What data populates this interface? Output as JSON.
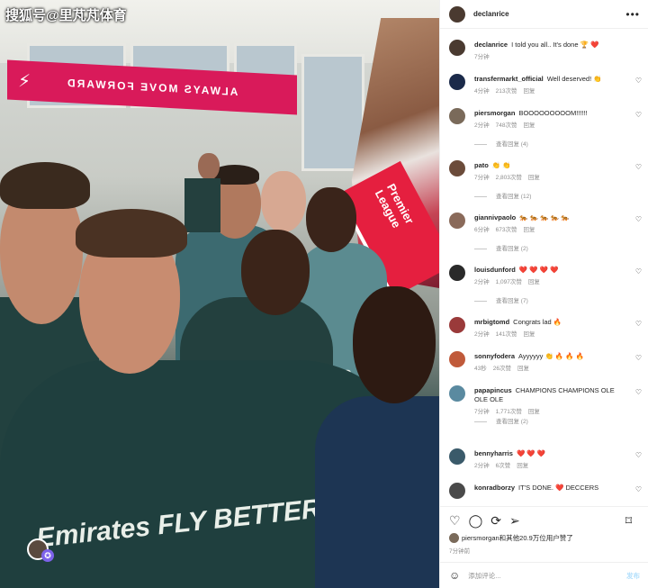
{
  "watermark": "搜狐号@里芃芃体育",
  "photo": {
    "banner_text": "ALWAYS MOVE FORWARD",
    "ribbon_text": "Premier League",
    "shirt_sponsor": "Emirates FLY BETTER"
  },
  "post": {
    "author": "declanrice",
    "more_icon": "more-horizontal-icon"
  },
  "comments": [
    {
      "user": "declanrice",
      "text": "I told you all.. It's done 🏆 ❤️",
      "time": "7分钟",
      "likes": "",
      "reply": "",
      "replies": "",
      "avatar_color": "#4a3a30"
    },
    {
      "user": "transfermarkt_official",
      "text": "Well deserved! 👏",
      "time": "4分钟",
      "likes": "213次赞",
      "reply": "回复",
      "replies": "",
      "avatar_color": "#1b2a4a"
    },
    {
      "user": "piersmorgan",
      "text": "BOOOOOOOOOM!!!!!!",
      "time": "2分钟",
      "likes": "748次赞",
      "reply": "回复",
      "replies": "查看回复 (4)",
      "avatar_color": "#7a6a5a"
    },
    {
      "user": "pato",
      "text": "👏 👏",
      "time": "7分钟",
      "likes": "2,803次赞",
      "reply": "回复",
      "replies": "查看回复 (12)",
      "avatar_color": "#6b4b3a"
    },
    {
      "user": "giannivpaolo",
      "text": "🐅 🐅 🐅 🐅 🐅",
      "time": "6分钟",
      "likes": "673次赞",
      "reply": "回复",
      "replies": "查看回复 (2)",
      "avatar_color": "#8a6a5a"
    },
    {
      "user": "louisdunford",
      "text": "❤️ ❤️ ❤️ ❤️",
      "time": "2分钟",
      "likes": "1,097次赞",
      "reply": "回复",
      "replies": "查看回复 (7)",
      "avatar_color": "#2a2a2a"
    },
    {
      "user": "mrbigtomd",
      "text": "Congrats lad 🔥",
      "time": "2分钟",
      "likes": "141次赞",
      "reply": "回复",
      "replies": "",
      "avatar_color": "#9a3a3a"
    },
    {
      "user": "sonnyfodera",
      "text": "Ayyyyyy 👏 🔥 🔥 🔥",
      "time": "43秒",
      "likes": "26次赞",
      "reply": "回复",
      "replies": "",
      "avatar_color": "#c05a3a"
    },
    {
      "user": "papapincus",
      "text": "CHAMPIONS CHAMPIONS OLE OLE OLE",
      "time": "7分钟",
      "likes": "1,771次赞",
      "reply": "回复",
      "replies": "查看回复 (2)",
      "avatar_color": "#5a8aa0"
    },
    {
      "user": "bennyharris",
      "text": "❤️ ❤️ ❤️",
      "time": "2分钟",
      "likes": "6次赞",
      "reply": "回复",
      "replies": "",
      "avatar_color": "#3a5a6a"
    },
    {
      "user": "konradborzy",
      "text": "IT'S DONE. ❤️ DECCERS",
      "time": "",
      "likes": "",
      "reply": "",
      "replies": "",
      "avatar_color": "#4a4a4a"
    }
  ],
  "actions": {
    "like_icon": "heart-icon",
    "comment_icon": "comment-icon",
    "share_icon": "repost-icon",
    "send_icon": "send-icon",
    "save_icon": "bookmark-icon"
  },
  "liked_by": "piersmorgan和其他20.9万位用户赞了",
  "post_time": "7分钟前",
  "add_comment": {
    "emoji_icon": "emoji-icon",
    "placeholder": "添加评论...",
    "post_label": "发布"
  }
}
